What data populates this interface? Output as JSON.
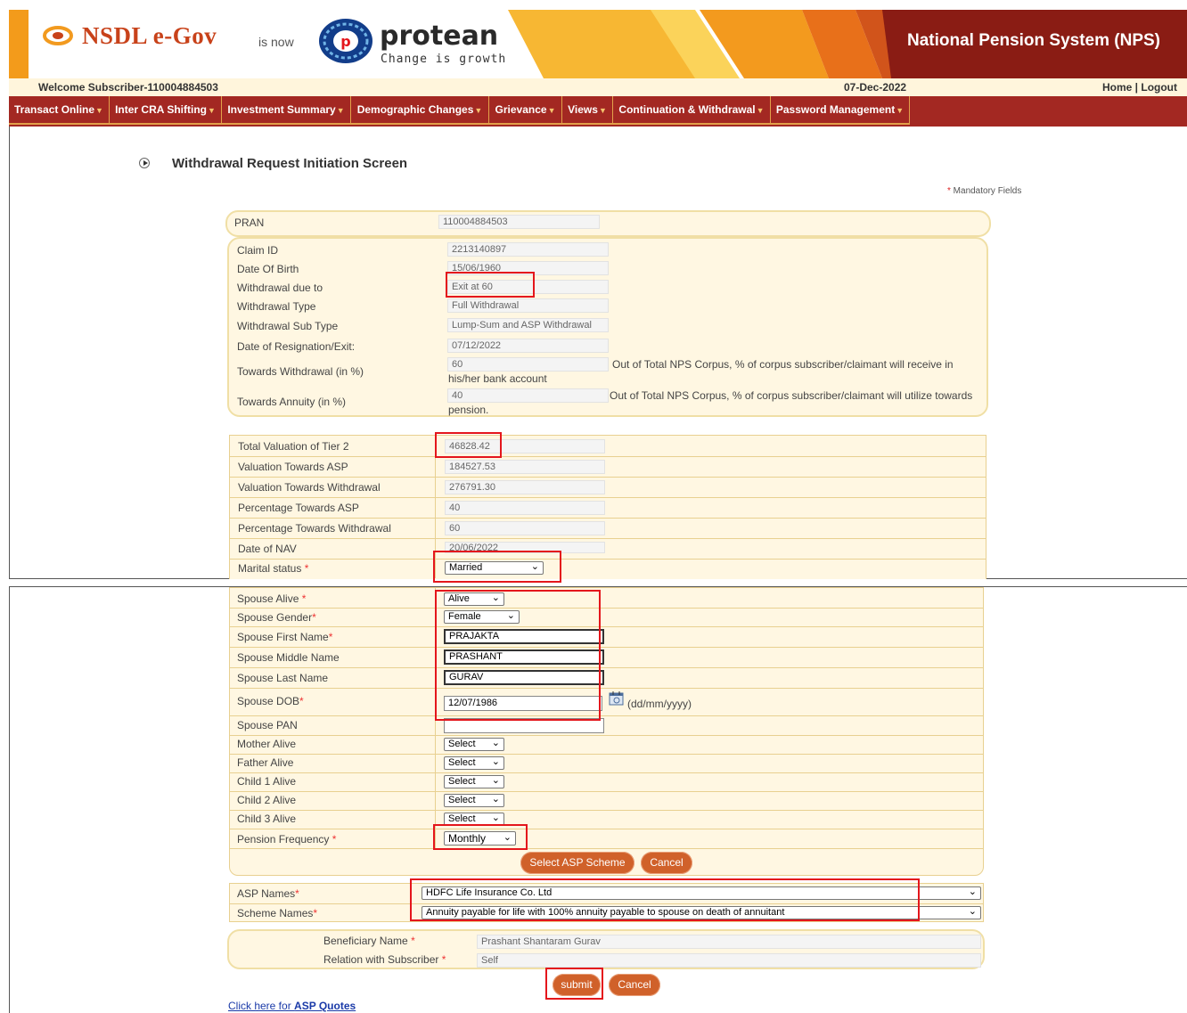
{
  "header": {
    "nsdl_logo": "NSDL e-Gov",
    "is_now": "is now",
    "protean_logo": "protean",
    "tagline": "Change is growth",
    "title": "National Pension System (NPS)"
  },
  "topbar": {
    "welcome": "Welcome Subscriber-110004884503",
    "date": "07-Dec-2022",
    "home_logout": "Home | Logout"
  },
  "menu": {
    "items": [
      {
        "label": "Transact Online"
      },
      {
        "label": "Inter CRA Shifting"
      },
      {
        "label": "Investment Summary"
      },
      {
        "label": "Demographic Changes"
      },
      {
        "label": "Grievance"
      },
      {
        "label": "Views"
      },
      {
        "label": "Continuation & Withdrawal"
      },
      {
        "label": "Password Management"
      }
    ]
  },
  "page": {
    "title": "Withdrawal Request Initiation Screen",
    "mandatory_note": "Mandatory Fields"
  },
  "pran": {
    "label": "PRAN",
    "value": "110004884503"
  },
  "claim": {
    "claim_id": {
      "label": "Claim ID",
      "value": "2213140897"
    },
    "dob": {
      "label": "Date Of Birth",
      "value": "15/06/1960"
    },
    "due_to": {
      "label": "Withdrawal due to",
      "value": "Exit at 60"
    },
    "type": {
      "label": "Withdrawal Type",
      "value": "Full Withdrawal"
    },
    "sub_type": {
      "label": "Withdrawal Sub Type",
      "value": "Lump-Sum and ASP Withdrawal"
    },
    "resignation": {
      "label": "Date of Resignation/Exit:",
      "value": "07/12/2022"
    },
    "towards_withdrawal": {
      "label": "Towards Withdrawal (in %)",
      "value": "60",
      "note1": "Out of Total NPS Corpus, % of corpus subscriber/claimant will receive in",
      "note2": "his/her bank account"
    },
    "towards_annuity": {
      "label": "Towards Annuity (in %)",
      "value": "40",
      "note1": "Out of Total NPS Corpus, % of corpus subscriber/claimant will utilize towards",
      "note2": "pension."
    }
  },
  "valuation": {
    "rows": [
      {
        "label": "Total Valuation of Tier 2",
        "value": "46828.42"
      },
      {
        "label": "Valuation Towards ASP",
        "value": "184527.53"
      },
      {
        "label": "Valuation Towards Withdrawal",
        "value": "276791.30"
      },
      {
        "label": "Percentage Towards ASP",
        "value": "40"
      },
      {
        "label": "Percentage Towards Withdrawal",
        "value": "60"
      },
      {
        "label": "Date of NAV",
        "value": "20/06/2022"
      }
    ],
    "marital_label": "Marital status",
    "marital_value": "Married"
  },
  "spouse": {
    "alive_label": "Spouse Alive",
    "alive_value": "Alive",
    "gender_label": "Spouse Gender",
    "gender_value": "Female",
    "first_label": "Spouse First Name",
    "first_value": "PRAJAKTA",
    "middle_label": "Spouse Middle Name",
    "middle_value": "PRASHANT",
    "last_label": "Spouse Last Name",
    "last_value": "GURAV",
    "dob_label": "Spouse DOB",
    "dob_value": "12/07/1986",
    "dob_hint": "(dd/mm/yyyy)",
    "pan_label": "Spouse PAN",
    "pan_value": "",
    "mother_label": "Mother Alive",
    "mother_value": "Select",
    "father_label": "Father Alive",
    "father_value": "Select",
    "child1_label": "Child 1 Alive",
    "child1_value": "Select",
    "child2_label": "Child 2 Alive",
    "child2_value": "Select",
    "child3_label": "Child 3 Alive",
    "child3_value": "Select",
    "freq_label": "Pension Frequency",
    "freq_value": "Monthly"
  },
  "buttons": {
    "select_asp": "Select ASP Scheme",
    "cancel": "Cancel",
    "submit": "submit",
    "cancel2": "Cancel"
  },
  "asp": {
    "names_label": "ASP Names",
    "names_value": "HDFC Life Insurance Co. Ltd",
    "scheme_label": "Scheme Names",
    "scheme_value": "Annuity payable for life with 100% annuity payable to spouse on death of annuitant"
  },
  "beneficiary": {
    "name_label": "Beneficiary Name",
    "name_value": "Prashant Shantaram Gurav",
    "relation_label": "Relation with Subscriber",
    "relation_value": "Self"
  },
  "link": {
    "prefix": "Click here for ",
    "bold": "ASP Quotes"
  },
  "colors": {
    "menu_bg": "#a32822",
    "panel_bg": "#fff7e2",
    "button": "#d0612a",
    "highlight": "#e4161c"
  }
}
